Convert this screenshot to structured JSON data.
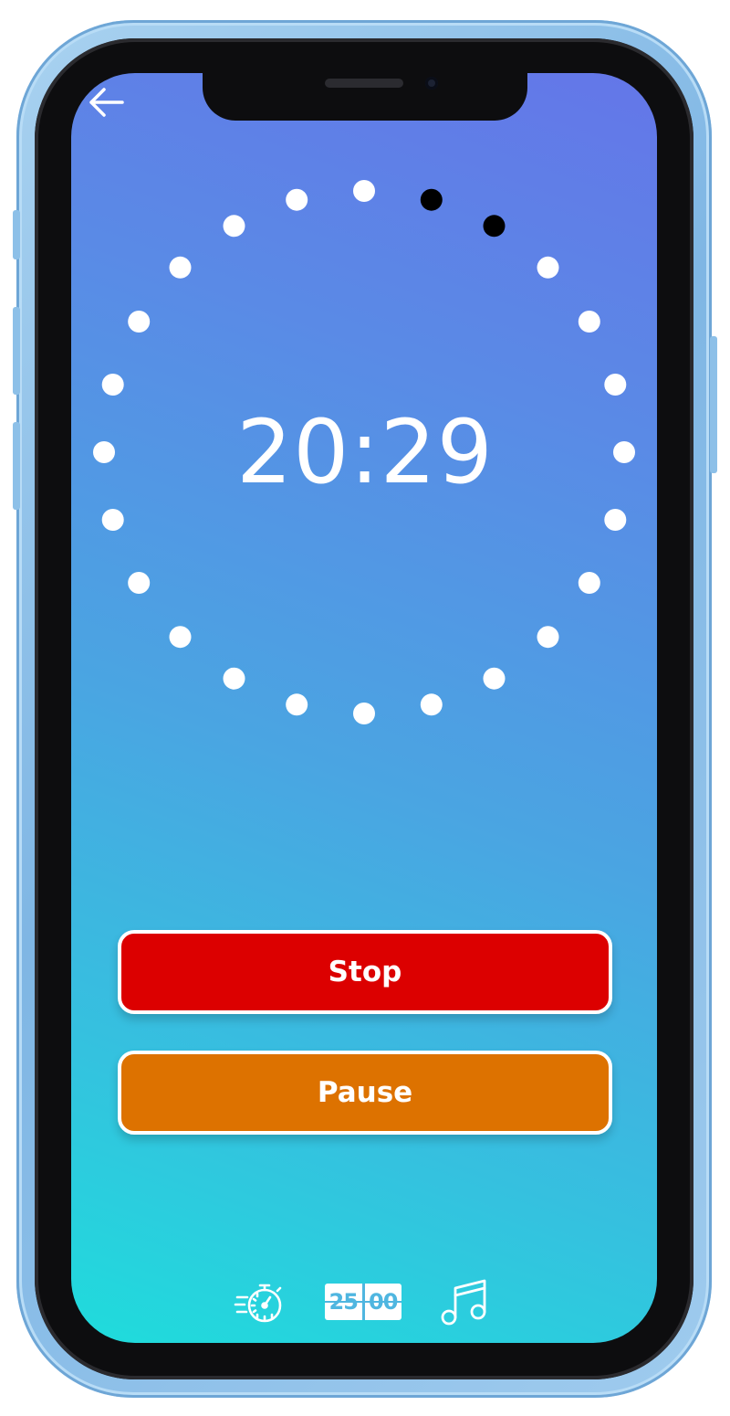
{
  "app": {
    "title": ""
  },
  "timer": {
    "time": "20:29",
    "dots_total": 24,
    "dots_elapsed": 2,
    "dot_color": "#ffffff",
    "elapsed_dot_color": "#000000"
  },
  "actions": {
    "stop_label": "Stop",
    "pause_label": "Pause",
    "stop_color": "#dc0000",
    "pause_color": "#dd7200"
  },
  "bottom_nav": {
    "items": [
      {
        "icon": "stopwatch-icon"
      },
      {
        "icon": "timer-duration-icon",
        "digits_left": "25",
        "digits_right": "00"
      },
      {
        "icon": "music-note-icon"
      }
    ]
  },
  "navigation": {
    "back_icon": "arrow-left-icon"
  }
}
